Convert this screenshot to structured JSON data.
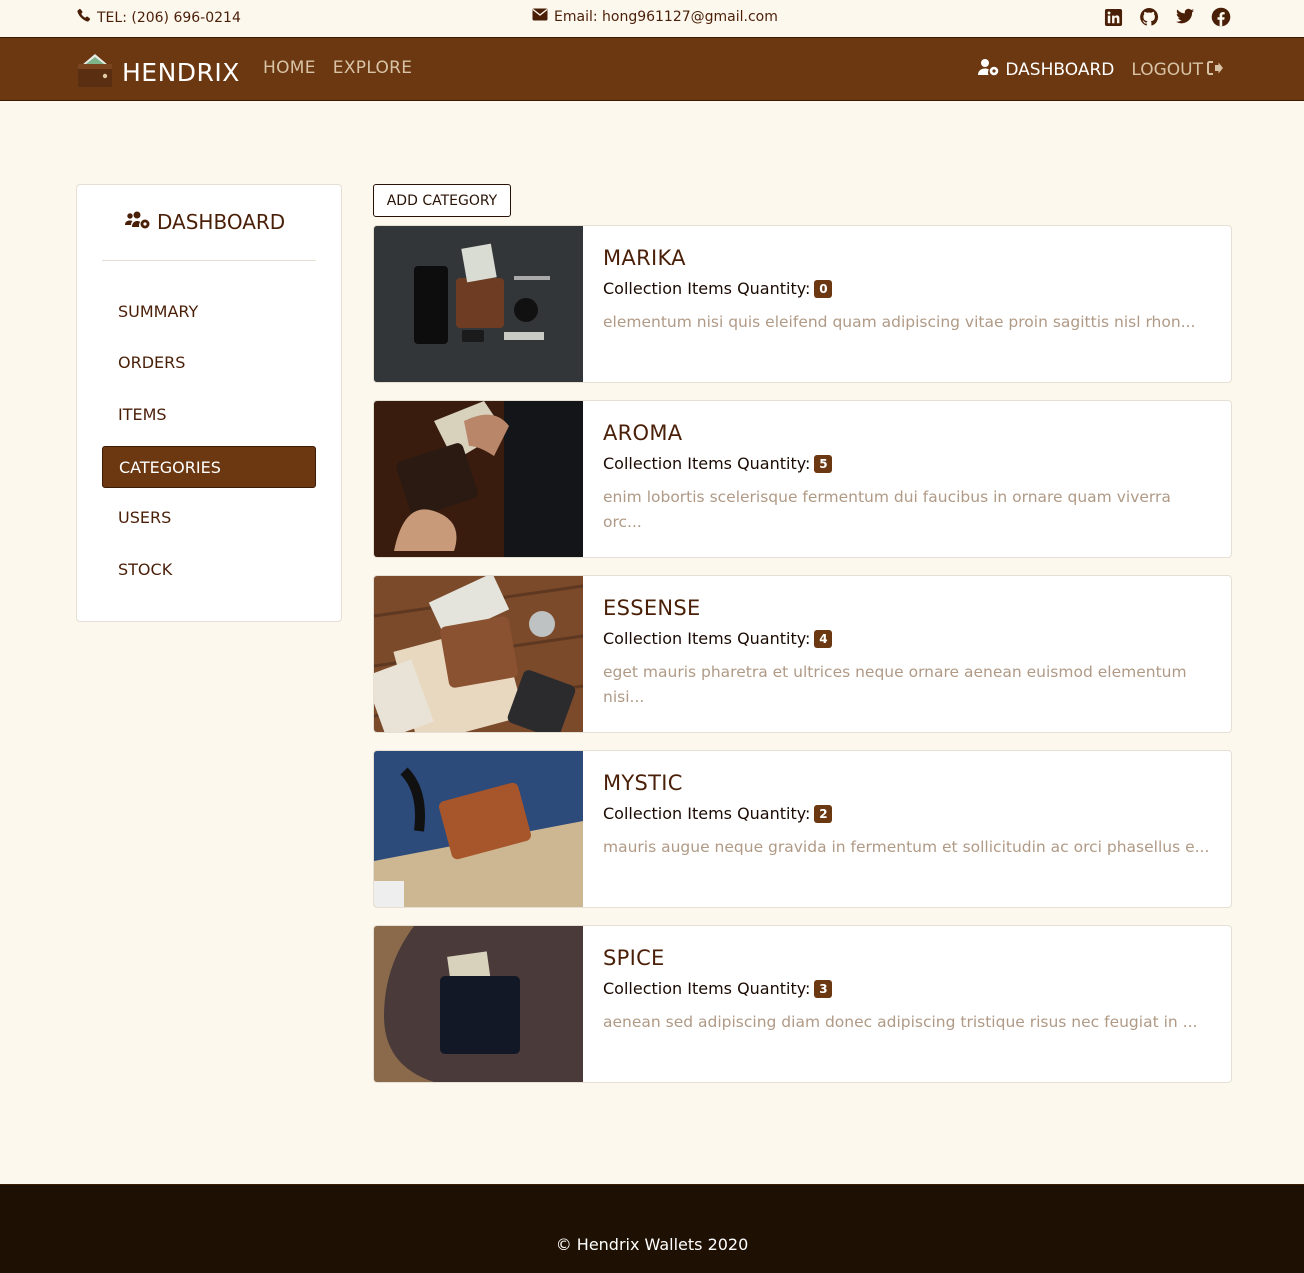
{
  "topbar": {
    "tel": "TEL: (206) 696-0214",
    "email": "Email: hong961127@gmail.com",
    "socials": [
      "linkedin-icon",
      "github-icon",
      "twitter-icon",
      "facebook-icon"
    ]
  },
  "navbar": {
    "brand": "HENDRIX",
    "links": [
      "HOME",
      "EXPLORE"
    ],
    "dashboard": "DASHBOARD",
    "logout": "LOGOUT"
  },
  "sidebar": {
    "title": "DASHBOARD",
    "items": [
      "SUMMARY",
      "ORDERS",
      "ITEMS",
      "CATEGORIES",
      "USERS",
      "STOCK"
    ],
    "active": "CATEGORIES"
  },
  "add_category_label": "ADD CATEGORY",
  "quantity_label": "Collection Items Quantity:",
  "categories": [
    {
      "name": "MARIKA",
      "quantity": "0",
      "description": "elementum nisi quis eleifend quam adipiscing vitae proin sagittis nisl rhon..."
    },
    {
      "name": "AROMA",
      "quantity": "5",
      "description": "enim lobortis scelerisque fermentum dui faucibus in ornare quam viverra orc..."
    },
    {
      "name": "ESSENSE",
      "quantity": "4",
      "description": "eget mauris pharetra et ultrices neque ornare aenean euismod elementum nisi..."
    },
    {
      "name": "MYSTIC",
      "quantity": "2",
      "description": "mauris augue neque gravida in fermentum et sollicitudin ac orci phasellus e..."
    },
    {
      "name": "SPICE",
      "quantity": "3",
      "description": "aenean sed adipiscing diam donec adipiscing tristique risus nec feugiat in ..."
    }
  ],
  "footer": "© Hendrix Wallets 2020",
  "colors": {
    "brand_brown": "#6b3811",
    "page_bg": "#fdf8ee",
    "footer_bg": "#1e1003"
  }
}
